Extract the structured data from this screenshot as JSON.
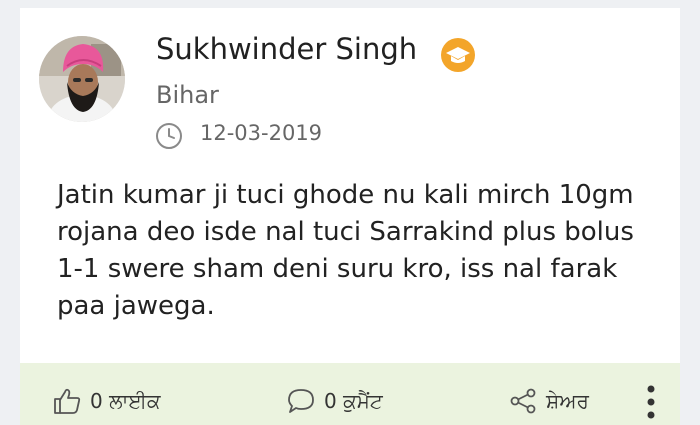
{
  "post": {
    "author_name": "Sukhwinder Singh",
    "location": "Bihar",
    "date": "12-03-2019",
    "text": "Jatin kumar ji tuci ghode nu kali mirch 10gm rojana deo isde nal tuci Sarrakind plus bolus 1-1 swere sham deni suru kro, iss nal farak paa jawega."
  },
  "actions": {
    "like_label": "0 ਲਾਈਕ",
    "comment_label": "0 ਕੁਮੈਂਟ",
    "share_label": "ਸ਼ੇਅਰ"
  },
  "icons": {
    "badge": "graduation-cap-badge-icon",
    "clock": "clock-icon",
    "like": "thumbs-up-icon",
    "comment": "speech-bubble-icon",
    "share": "share-icon",
    "more": "vertical-ellipsis-icon"
  },
  "colors": {
    "badge": "#f3a52a",
    "action_bar_bg": "#ebf3df",
    "turban": "#e8589a"
  }
}
